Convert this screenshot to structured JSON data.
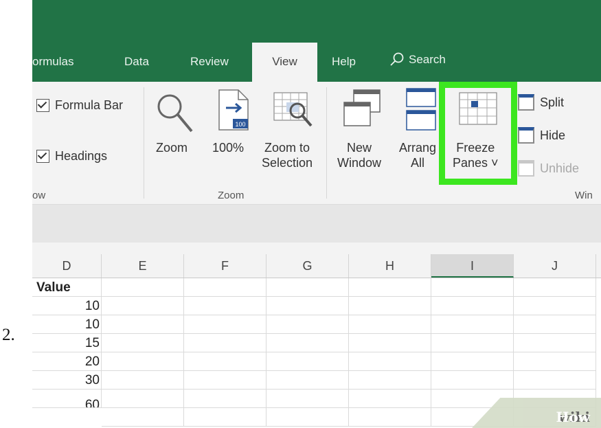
{
  "step_number": "2.",
  "tabs": [
    "ormulas",
    "Data",
    "Review",
    "View",
    "Help"
  ],
  "active_tab": "View",
  "search_label": "Search",
  "show_group": {
    "formula_bar_label": "Formula Bar",
    "formula_bar_checked": true,
    "headings_label": "Headings",
    "headings_checked": true,
    "group_label": "ow"
  },
  "zoom_group": {
    "zoom_label": "Zoom",
    "hundred_label": "100%",
    "hundred_icon_text": "100",
    "zoom_selection_line1": "Zoom to",
    "zoom_selection_line2": "Selection",
    "group_label": "Zoom"
  },
  "window_group": {
    "new_window_line1": "New",
    "new_window_line2": "Window",
    "arrange_line1": "Arrang",
    "arrange_line2": "All",
    "freeze_line1": "Freeze",
    "freeze_line2": "Panes ˅",
    "split_label": "Split",
    "hide_label": "Hide",
    "unhide_label": "Unhide",
    "group_label": "Win"
  },
  "columns": [
    "D",
    "E",
    "F",
    "G",
    "H",
    "I",
    "J"
  ],
  "selected_column": "I",
  "column_d_values": [
    "Value",
    "10",
    "10",
    "15",
    "20",
    "30",
    "60"
  ],
  "watermark": {
    "part1": "wiki",
    "part2": "How"
  },
  "colors": {
    "title_bar": "#217346",
    "highlight": "#3ce61f",
    "icon_blue": "#2b579a"
  }
}
